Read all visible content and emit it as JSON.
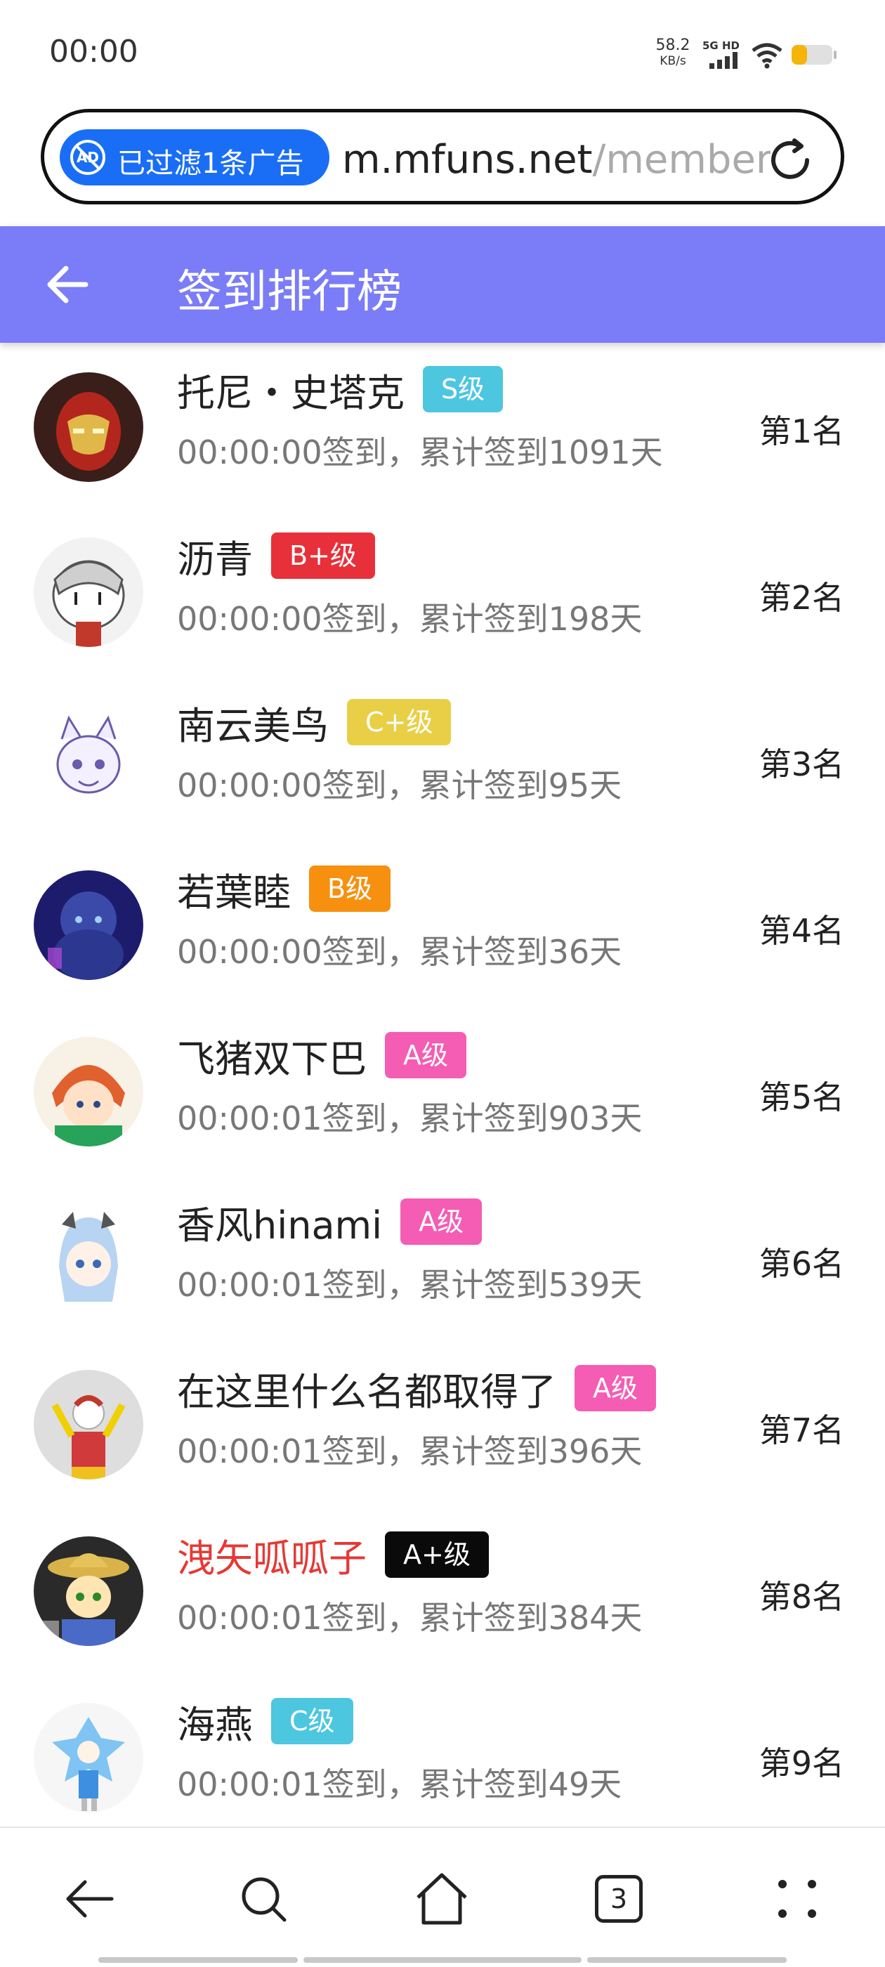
{
  "status_bar": {
    "time": "00:00",
    "net_speed": "58.2",
    "net_speed_unit": "KB/s",
    "signal_label": "5G HD"
  },
  "url_bar": {
    "ad_filter_text": "已过滤1条广告",
    "url_host": "m.mfuns.net",
    "url_path": "/member"
  },
  "header": {
    "title": "签到排行榜"
  },
  "entries": [
    {
      "name": "托尼・史塔克",
      "badge": "S级",
      "badge_color": "#4dc6e0",
      "meta": "00:00:00签到，累计签到1091天",
      "rank": "第1名",
      "name_color": "#222222"
    },
    {
      "name": "沥青",
      "badge": "B+级",
      "badge_color": "#e8303a",
      "meta": "00:00:00签到，累计签到198天",
      "rank": "第2名",
      "name_color": "#222222"
    },
    {
      "name": "南云美鸟",
      "badge": "C+级",
      "badge_color": "#e9cf46",
      "meta": "00:00:00签到，累计签到95天",
      "rank": "第3名",
      "name_color": "#222222"
    },
    {
      "name": "若葉睦",
      "badge": "B级",
      "badge_color": "#f7900f",
      "meta": "00:00:00签到，累计签到36天",
      "rank": "第4名",
      "name_color": "#222222"
    },
    {
      "name": "飞猪双下巴",
      "badge": "A级",
      "badge_color": "#f45db3",
      "meta": "00:00:01签到，累计签到903天",
      "rank": "第5名",
      "name_color": "#222222"
    },
    {
      "name": "香风hinami",
      "badge": "A级",
      "badge_color": "#f45db3",
      "meta": "00:00:01签到，累计签到539天",
      "rank": "第6名",
      "name_color": "#222222"
    },
    {
      "name": "在这里什么名都取得了",
      "badge": "A级",
      "badge_color": "#f45db3",
      "meta": "00:00:01签到，累计签到396天",
      "rank": "第7名",
      "name_color": "#222222"
    },
    {
      "name": "洩矢呱呱子",
      "badge": "A+级",
      "badge_color": "#0a0a0a",
      "meta": "00:00:01签到，累计签到384天",
      "rank": "第8名",
      "name_color": "#e53935"
    },
    {
      "name": "海燕",
      "badge": "C级",
      "badge_color": "#4dc6e0",
      "meta": "00:00:01签到，累计签到49天",
      "rank": "第9名",
      "name_color": "#222222"
    }
  ],
  "bottom_nav": {
    "tab_count": "3"
  },
  "colors": {
    "header_bg": "#7b7cf7",
    "ad_pill_bg": "#1a6ef5"
  }
}
